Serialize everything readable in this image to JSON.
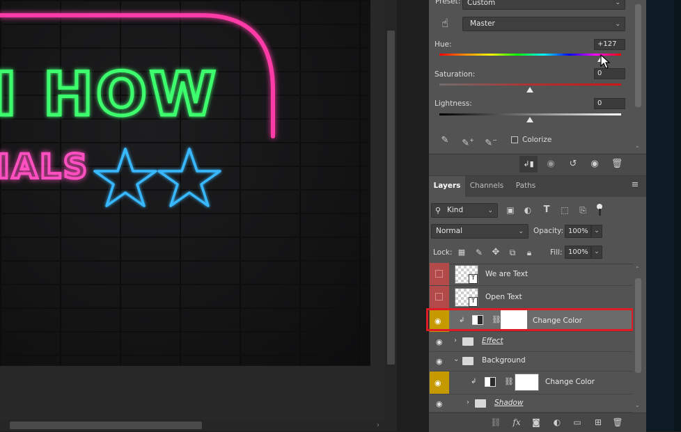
{
  "canvas": {
    "neon_title": "I HOW",
    "neon_subtitle": "IALS"
  },
  "properties": {
    "preset_label": "Preset:",
    "preset_value": "Custom",
    "channel_value": "Master",
    "hue_label": "Hue:",
    "hue_value": "+127",
    "saturation_label": "Saturation:",
    "saturation_value": "0",
    "lightness_label": "Lightness:",
    "lightness_value": "0",
    "colorize_label": "Colorize"
  },
  "layers_panel": {
    "tabs": [
      "Layers",
      "Channels",
      "Paths"
    ],
    "filter_kind": "Kind",
    "blend_mode": "Normal",
    "opacity_label": "Opacity:",
    "opacity_value": "100%",
    "lock_label": "Lock:",
    "fill_label": "Fill:",
    "fill_value": "100%",
    "layers": [
      {
        "name": "We are Text",
        "type": "text",
        "visible": false
      },
      {
        "name": "Open Text",
        "type": "text",
        "visible": false
      },
      {
        "name": "Change Color",
        "type": "adjustment",
        "visible": true,
        "selected": true
      },
      {
        "name": "Effect",
        "type": "group",
        "visible": true
      },
      {
        "name": "Background",
        "type": "group",
        "visible": true,
        "expanded": true
      },
      {
        "name": "Change Color",
        "type": "adjustment",
        "visible": true
      },
      {
        "name": "Shadow",
        "type": "group",
        "visible": true
      }
    ]
  },
  "colors": {
    "selection_highlight": "#e01b24",
    "hidden_layer_red": "#b34a4a",
    "visible_eye_gold": "#c49a00",
    "neon_green": "#39ff6a",
    "neon_pink": "#ff2aa0",
    "neon_blue": "#2bb8ff"
  }
}
